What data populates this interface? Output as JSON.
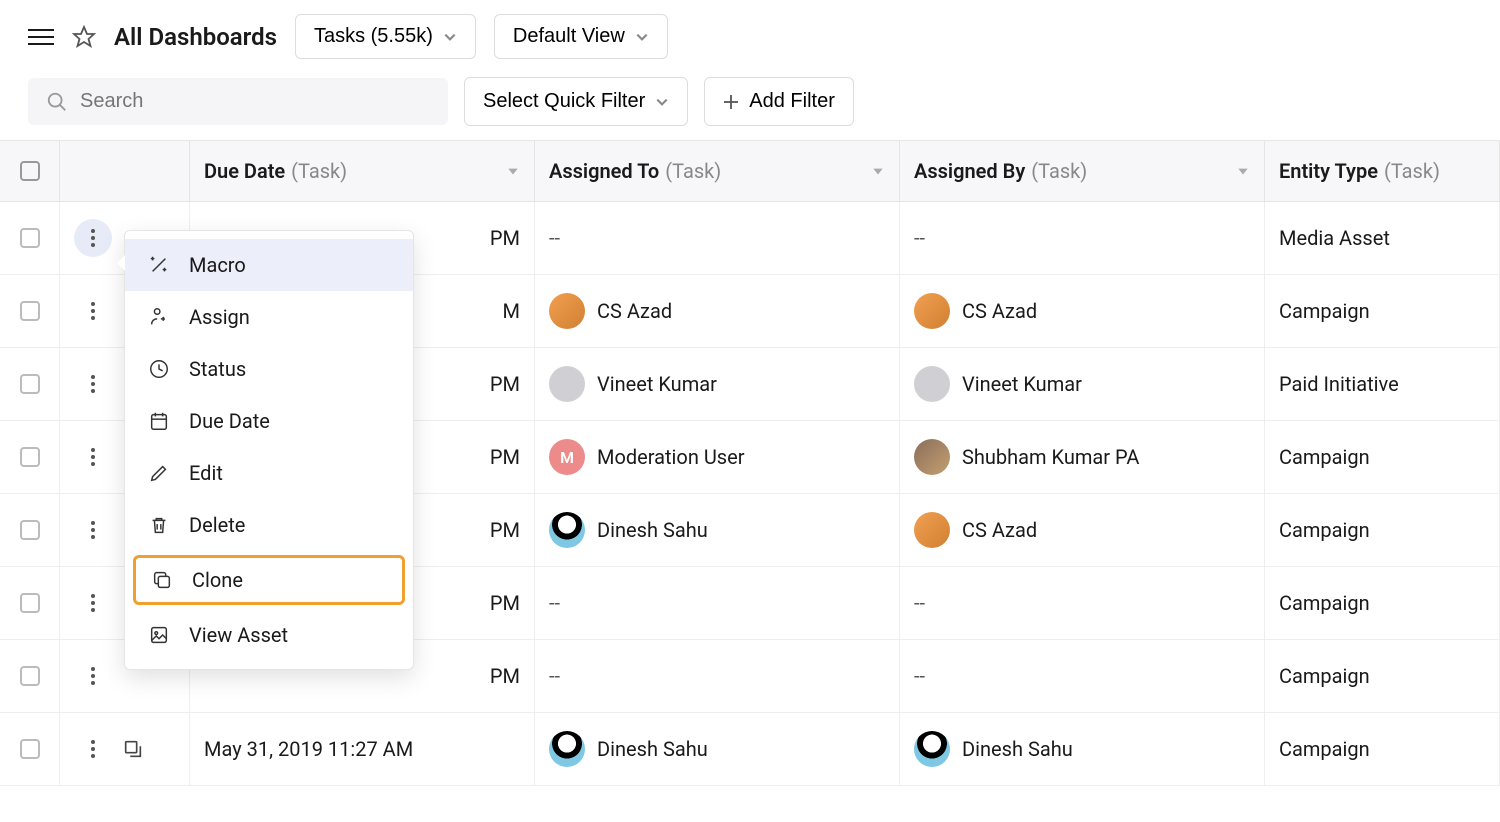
{
  "header": {
    "title": "All Dashboards",
    "tasks_label": "Tasks (5.55k)",
    "view_label": "Default View"
  },
  "filters": {
    "search_placeholder": "Search",
    "quick_filter_label": "Select Quick Filter",
    "add_filter_label": "Add Filter"
  },
  "columns": {
    "due_date": {
      "label": "Due Date",
      "sub": "(Task)"
    },
    "assigned_to": {
      "label": "Assigned To",
      "sub": "(Task)"
    },
    "assigned_by": {
      "label": "Assigned By",
      "sub": "(Task)"
    },
    "entity_type": {
      "label": "Entity Type",
      "sub": "(Task)"
    }
  },
  "context_menu": {
    "macro": "Macro",
    "assign": "Assign",
    "status": "Status",
    "due_date": "Due Date",
    "edit": "Edit",
    "delete": "Delete",
    "clone": "Clone",
    "view_asset": "View Asset"
  },
  "rows": [
    {
      "due": "PM",
      "assigned_to": "--",
      "assigned_by": "--",
      "entity": "Media Asset",
      "to_avatar": "none",
      "by_avatar": "none",
      "active_dots": true
    },
    {
      "due": "M",
      "assigned_to": "CS Azad",
      "assigned_by": "CS Azad",
      "entity": "Campaign",
      "to_avatar": "orange",
      "by_avatar": "orange"
    },
    {
      "due": "PM",
      "assigned_to": "Vineet Kumar",
      "assigned_by": "Vineet Kumar",
      "entity": "Paid Initiative",
      "to_avatar": "grey",
      "by_avatar": "grey"
    },
    {
      "due": "PM",
      "assigned_to": "Moderation User",
      "to_letter": "M",
      "assigned_by": "Shubham Kumar PA",
      "entity": "Campaign",
      "to_avatar": "pink",
      "by_avatar": "photo"
    },
    {
      "due": "PM",
      "assigned_to": "Dinesh Sahu",
      "assigned_by": "CS Azad",
      "entity": "Campaign",
      "to_avatar": "penguin",
      "by_avatar": "orange"
    },
    {
      "due": "PM",
      "assigned_to": "--",
      "assigned_by": "--",
      "entity": "Campaign",
      "to_avatar": "none",
      "by_avatar": "none"
    },
    {
      "due": "PM",
      "assigned_to": "--",
      "assigned_by": "--",
      "entity": "Campaign",
      "to_avatar": "none",
      "by_avatar": "none"
    },
    {
      "due": "May 31, 2019 11:27 AM",
      "assigned_to": "Dinesh Sahu",
      "assigned_by": "Dinesh Sahu",
      "entity": "Campaign",
      "to_avatar": "penguin",
      "by_avatar": "penguin",
      "show_expand": true
    }
  ]
}
